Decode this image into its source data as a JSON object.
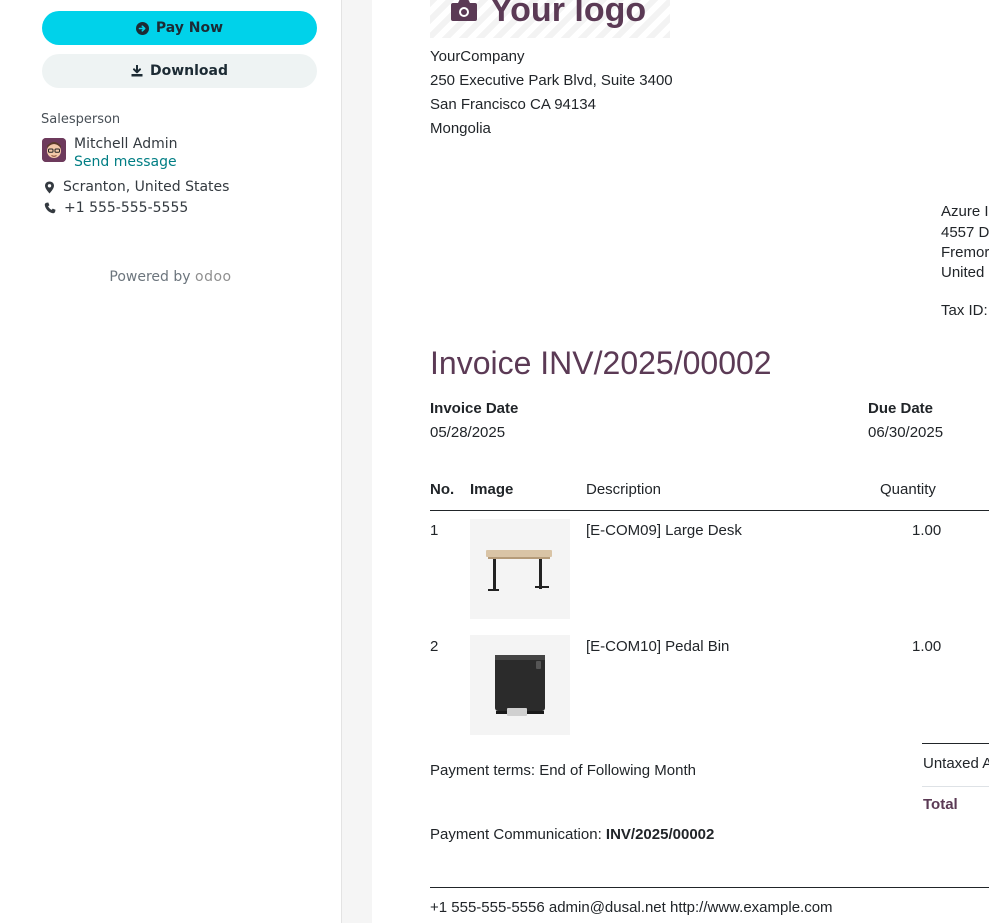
{
  "sidebar": {
    "pay_now_label": "Pay Now",
    "download_label": "Download",
    "salesperson_label": "Salesperson",
    "salesperson_name": "Mitchell Admin",
    "send_message_label": "Send message",
    "location": "Scranton, United States",
    "phone": "+1 555-555-5555",
    "powered_by_label": "Powered by",
    "powered_by_brand": "odoo"
  },
  "document": {
    "logo_text": "Your logo",
    "company": {
      "name": "YourCompany",
      "street": "250 Executive Park Blvd, Suite 3400",
      "city": "San Francisco CA 94134",
      "country": "Mongolia"
    },
    "client": {
      "line1": "Azure I",
      "line2": "4557 D",
      "line3": "Fremor",
      "line4": "United",
      "tax_id": "Tax ID:"
    },
    "title": "Invoice INV/2025/00002",
    "invoice_date_label": "Invoice Date",
    "invoice_date": "05/28/2025",
    "due_date_label": "Due Date",
    "due_date": "06/30/2025",
    "table": {
      "headers": [
        "No.",
        "Image",
        "Description",
        "Quantity"
      ],
      "rows": [
        {
          "no": "1",
          "image": "desk-image",
          "description": "[E-COM09] Large Desk",
          "quantity": "1.00"
        },
        {
          "no": "2",
          "image": "bin-image",
          "description": "[E-COM10] Pedal Bin",
          "quantity": "1.00"
        }
      ]
    },
    "payment_terms": "Payment terms: End of Following Month",
    "payment_communication_label": "Payment Communication:",
    "payment_communication_value": "INV/2025/00002",
    "totals": {
      "untaxed_label": "Untaxed A",
      "total_label": "Total"
    },
    "footer": "+1 555-555-5556 admin@dusal.net http://www.example.com"
  },
  "colors": {
    "pay_button": "#00d2ea",
    "download_button": "#eef3f3",
    "link": "#017e84",
    "invoice_title": "#5b3a55"
  }
}
